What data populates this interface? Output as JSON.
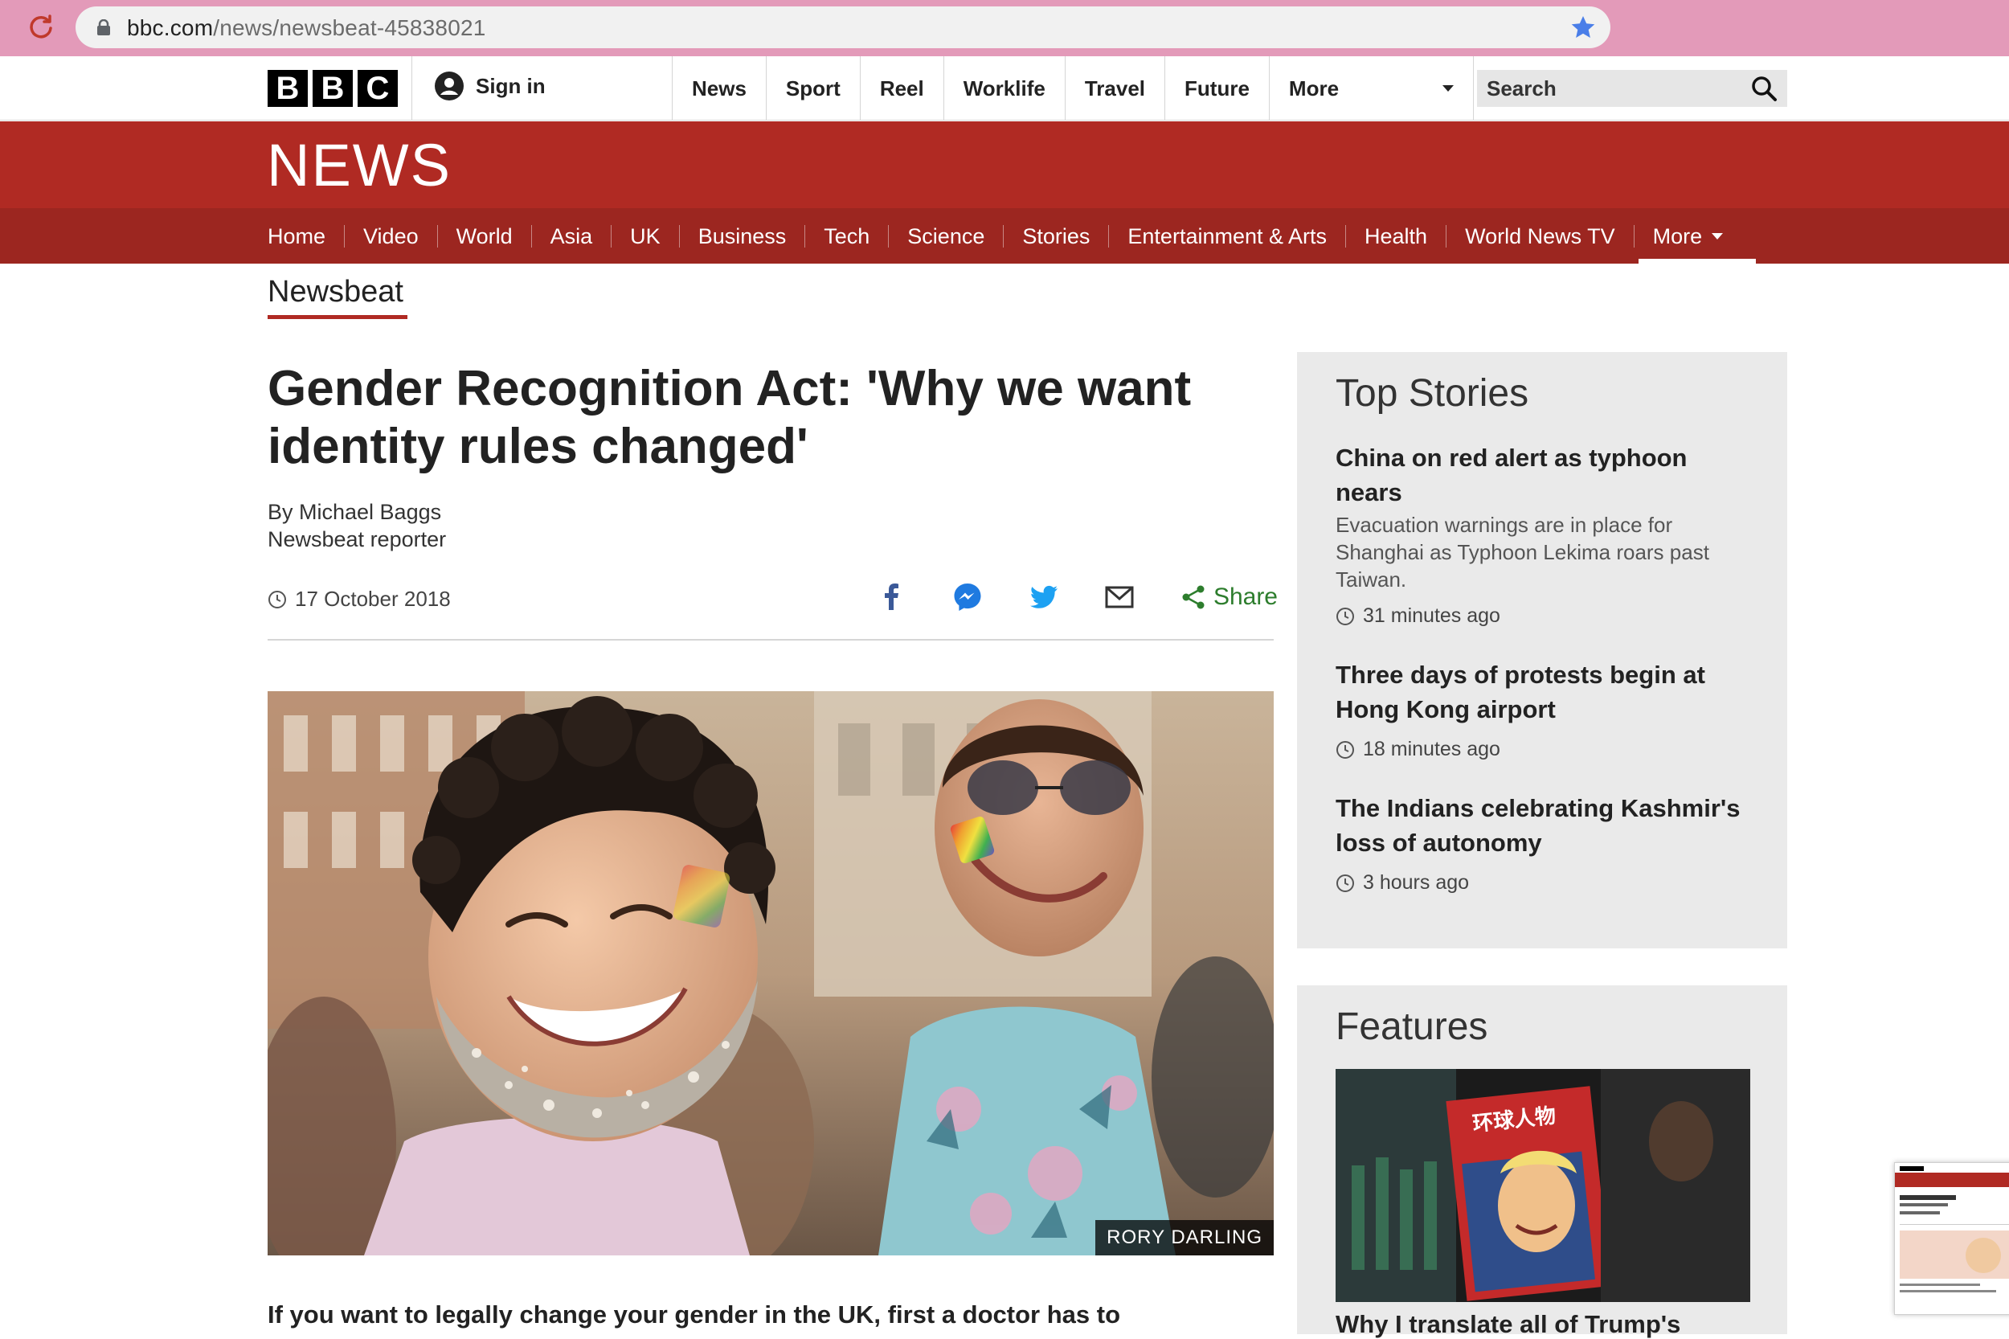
{
  "browser": {
    "url_domain": "bbc.com",
    "url_path": "/news/newsbeat-45838021"
  },
  "topbar": {
    "logo_letters": [
      "B",
      "B",
      "C"
    ],
    "sign_in": "Sign in",
    "nav": [
      "News",
      "Sport",
      "Reel",
      "Worklife",
      "Travel",
      "Future"
    ],
    "more": "More",
    "search_placeholder": "Search"
  },
  "banner": {
    "title": "NEWS"
  },
  "subnav": {
    "items": [
      "Home",
      "Video",
      "World",
      "Asia",
      "UK",
      "Business",
      "Tech",
      "Science",
      "Stories",
      "Entertainment & Arts",
      "Health",
      "World News TV"
    ],
    "more": "More"
  },
  "section": {
    "title": "Newsbeat"
  },
  "article": {
    "headline": "Gender Recognition Act: 'Why we want identity rules changed'",
    "author": "By Michael Baggs",
    "author_role": "Newsbeat reporter",
    "date": "17 October 2018",
    "share_label": "Share",
    "photo_credit": "RORY DARLING",
    "lede": "If you want to legally change your gender in the UK, first a doctor has to"
  },
  "sidebar": {
    "top_stories_title": "Top Stories",
    "stories": [
      {
        "title": "China on red alert as typhoon nears",
        "summary": "Evacuation warnings are in place for Shanghai as Typhoon Lekima roars past Taiwan.",
        "time": "31 minutes ago"
      },
      {
        "title": "Three days of protests begin at Hong Kong airport",
        "summary": "",
        "time": "18 minutes ago"
      },
      {
        "title": "The Indians celebrating Kashmir's loss of autonomy",
        "summary": "",
        "time": "3 hours ago"
      }
    ],
    "features_title": "Features",
    "feature_magazine_text": "环球人物",
    "feature_title": "Why I translate all of Trump's"
  },
  "colors": {
    "bbc_red": "#b02a23",
    "bbc_red_dark": "#9c2620",
    "share_green": "#2d7d2d",
    "chrome_pink": "#e39ab9"
  }
}
